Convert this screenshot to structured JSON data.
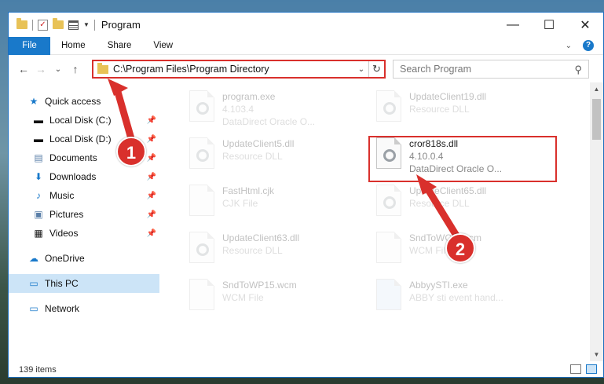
{
  "window": {
    "title": "Program",
    "minimize": "—",
    "maximize": "☐",
    "close": "✕"
  },
  "ribbon": {
    "file": "File",
    "tabs": [
      "Home",
      "Share",
      "View"
    ],
    "help": "?"
  },
  "nav": {
    "back": "←",
    "forward": "→",
    "recent": "⌄",
    "up": "↑",
    "address": "C:\\Program Files\\Program Directory",
    "refresh": "↻",
    "search_placeholder": "Search Program"
  },
  "sidebar": {
    "quick_access": "Quick access",
    "items": [
      {
        "label": "Local Disk (C:)",
        "icon": "drive-icon",
        "pinned": true
      },
      {
        "label": "Local Disk (D:)",
        "icon": "drive-icon",
        "pinned": true
      },
      {
        "label": "Documents",
        "icon": "documents-icon",
        "pinned": true
      },
      {
        "label": "Downloads",
        "icon": "downloads-icon",
        "pinned": true
      },
      {
        "label": "Music",
        "icon": "music-icon",
        "pinned": true
      },
      {
        "label": "Pictures",
        "icon": "pictures-icon",
        "pinned": true
      },
      {
        "label": "Videos",
        "icon": "videos-icon",
        "pinned": true
      }
    ],
    "onedrive": "OneDrive",
    "this_pc": "This PC",
    "network": "Network"
  },
  "files": [
    {
      "name": "program.exe",
      "meta": "4.103.4",
      "desc": "DataDirect Oracle O..."
    },
    {
      "name": "UpdateClient19.dll",
      "meta": "Resource DLL",
      "desc": ""
    },
    {
      "name": "UpdateClient5.dll",
      "meta": "Resource DLL",
      "desc": ""
    },
    {
      "name": "cror818s.dll",
      "meta": "4.10.0.4",
      "desc": "DataDirect Oracle O..."
    },
    {
      "name": "FastHtml.cjk",
      "meta": "CJK File",
      "desc": ""
    },
    {
      "name": "UpdateClient65.dll",
      "meta": "Resource DLL",
      "desc": ""
    },
    {
      "name": "UpdateClient63.dll",
      "meta": "Resource DLL",
      "desc": ""
    },
    {
      "name": "SndToWCM.wcm",
      "meta": "WCM File",
      "desc": ""
    },
    {
      "name": "SndToWP15.wcm",
      "meta": "WCM File",
      "desc": ""
    },
    {
      "name": "AbbyySTI.exe",
      "meta": "ABBY sti event hand...",
      "desc": ""
    }
  ],
  "status": {
    "count": "139 items"
  },
  "callouts": [
    "1",
    "2"
  ],
  "colors": {
    "accent": "#1979ca",
    "highlight": "#d9302c",
    "selected": "#cce4f7"
  }
}
